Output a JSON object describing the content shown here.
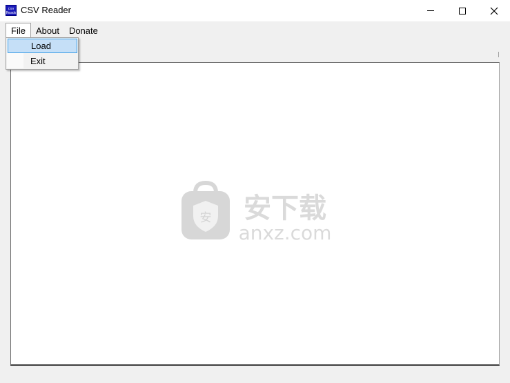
{
  "window": {
    "title": "CSV Reader",
    "icon": "csv-app-icon",
    "icon_text": "csv\nReader",
    "controls": [
      "minimize-icon",
      "maximize-icon",
      "close-icon"
    ]
  },
  "menubar": {
    "items": [
      {
        "label": "File",
        "open": true
      },
      {
        "label": "About",
        "open": false
      },
      {
        "label": "Donate",
        "open": false
      }
    ]
  },
  "file_menu": {
    "items": [
      {
        "label": "Load",
        "highlighted": true
      },
      {
        "label": "Exit",
        "highlighted": false
      }
    ]
  },
  "watermark": {
    "icon": "shield-bag-icon",
    "text_cn": "安下载",
    "text_domain": "anxz.com"
  },
  "colors": {
    "menu_highlight": "#c5dff7",
    "menu_highlight_border": "#3c9ee6",
    "form_background": "#f0f0f0",
    "app_icon_blue": "#1a1ab8"
  }
}
